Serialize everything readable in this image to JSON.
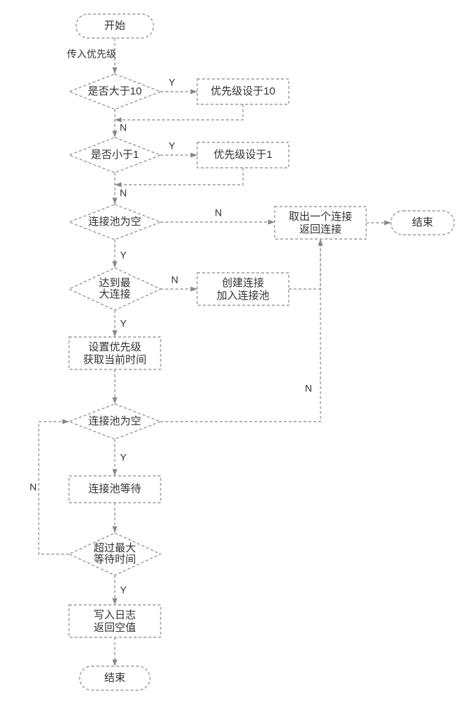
{
  "nodes": {
    "start": "开始",
    "end_top": "结束",
    "end_bottom": "结束",
    "input_priority": "传入优先级",
    "gt10": "是否大于10",
    "set10": "优先级设于10",
    "lt1": "是否小于1",
    "set1": "优先级设于1",
    "pool_empty_1": "连接池为空",
    "take_conn_l1": "取出一个连接",
    "take_conn_l2": "返回连接",
    "max_conn_l1": "达到最",
    "max_conn_l2": "大连接",
    "create_conn_l1": "创建连接",
    "create_conn_l2": "加入连接池",
    "set_pri_l1": "设置优先级",
    "set_pri_l2": "获取当前时间",
    "pool_empty_2": "连接池为空",
    "pool_wait": "连接池等待",
    "over_wait_l1": "超过最大",
    "over_wait_l2": "等待时间",
    "write_log_l1": "写入日志",
    "write_log_l2": "返回空值"
  },
  "labels": {
    "Y": "Y",
    "N": "N"
  }
}
